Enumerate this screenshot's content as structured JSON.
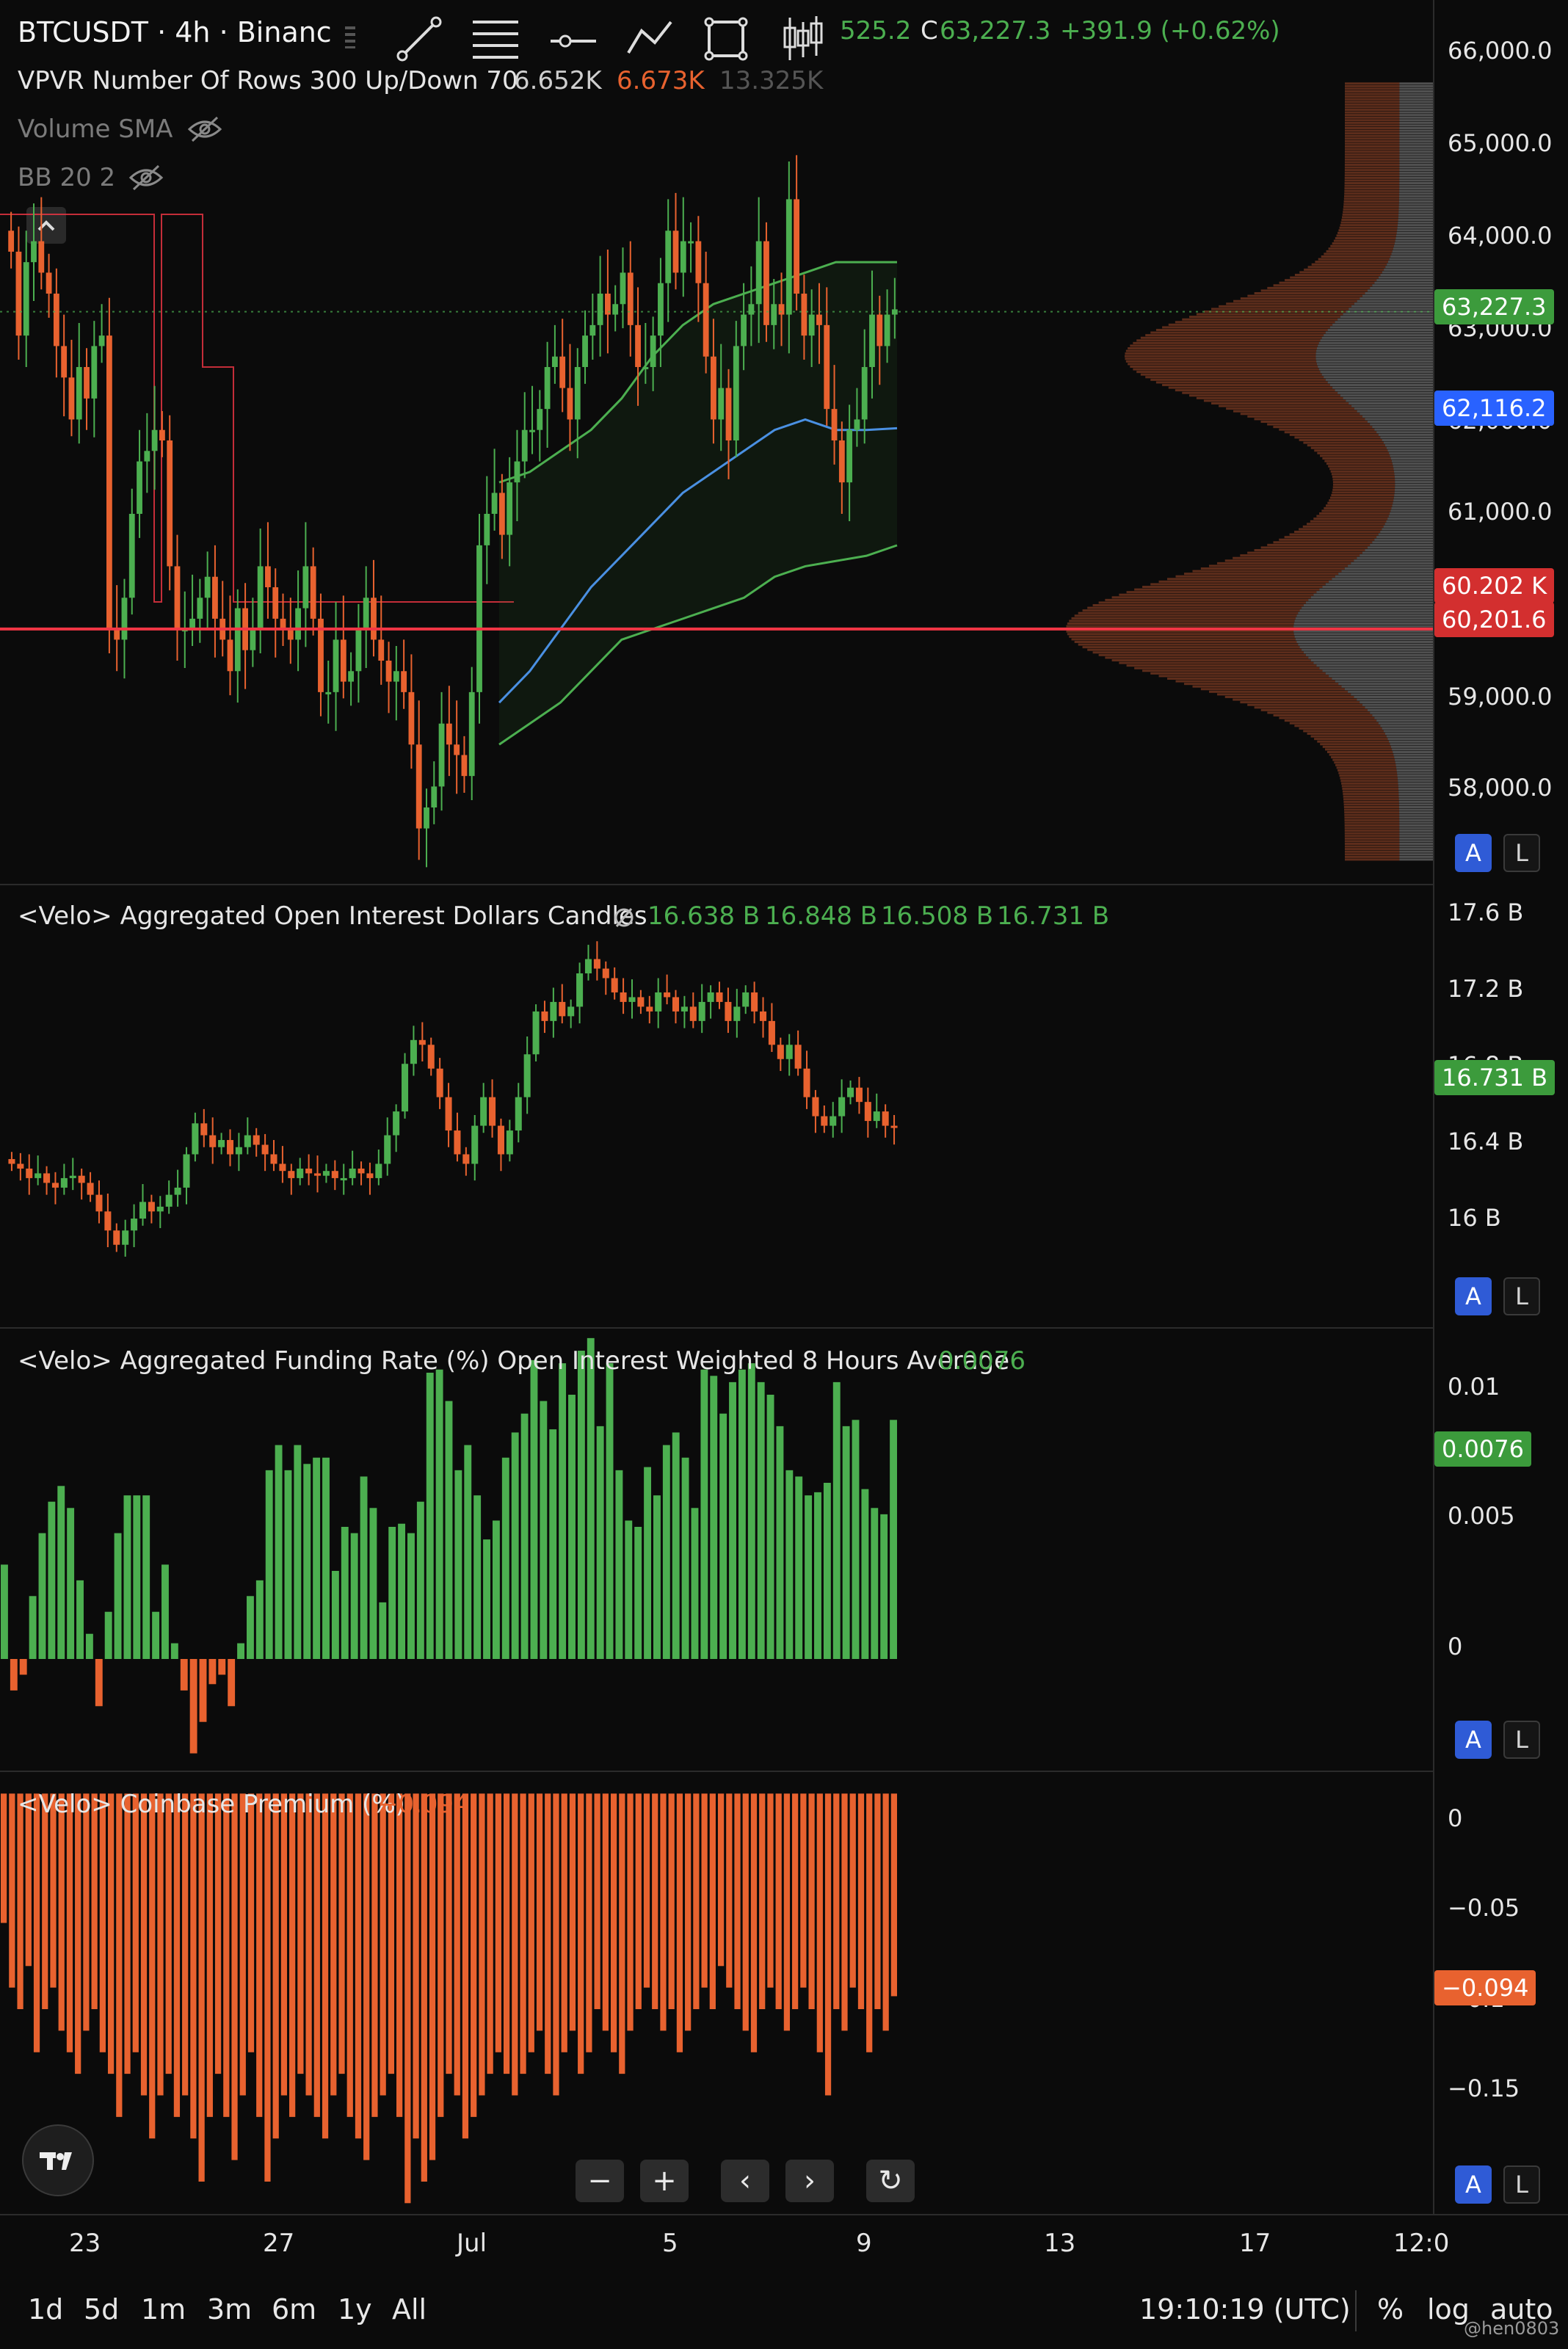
{
  "header": {
    "symbol": "BTCUSDT · 4h · Binanc",
    "ohlc_tail": "525.2",
    "close_letter": "C",
    "close_value": "63,227.3",
    "change": "+391.9 (+0.62%)"
  },
  "indicators": {
    "vpvr": {
      "name": "VPVR Number Of Rows 300 Up/Down 70",
      "v1": "6.652K",
      "v2": "6.673K",
      "v3": "13.325K"
    },
    "volume_sma": "Volume SMA",
    "bb": "BB 20 2"
  },
  "colors": {
    "up": "#4caf50",
    "down": "#e8622f",
    "line_red": "#f23645",
    "ma_blue": "#4a90e2",
    "badge_green": "#3c9b3c",
    "badge_blue": "#2962ff",
    "badge_red": "#d32f2f",
    "badge_orange": "#e8622f",
    "al_blue": "#2f5bd6"
  },
  "price_pane": {
    "yticks": [
      "66,000.0",
      "65,000.0",
      "64,000.0",
      "63,000.0",
      "62,000.0",
      "61,000.0",
      "59,000.0",
      "58,000.0"
    ],
    "badges": {
      "last": "63,227.3",
      "ma": "62,116.2",
      "line1": "60.202 K",
      "line2": "60,201.6"
    }
  },
  "oi_pane": {
    "title": "<Velo> Aggregated Open Interest Dollars Candles",
    "o": "16.638 B",
    "h": "16.848 B",
    "l": "16.508 B",
    "c": "16.731 B",
    "yticks": [
      "17.6 B",
      "17.2 B",
      "16.8 B",
      "16.4 B",
      "16 B"
    ],
    "badge": "16.731 B"
  },
  "funding_pane": {
    "title": "<Velo> Aggregated Funding Rate (%) Open Interest Weighted 8 Hours Average",
    "value": "0.0076",
    "yticks": [
      "0.01",
      "0.005",
      "0"
    ],
    "badge": "0.0076"
  },
  "premium_pane": {
    "title": "<Velo> Coinbase Premium (%)",
    "value": "−0.094",
    "yticks": [
      "0",
      "−0.05",
      "−0.1",
      "−0.15"
    ],
    "badge": "−0.094"
  },
  "scale_buttons": {
    "auto_label": "A",
    "log_label": "L"
  },
  "xaxis": [
    "23",
    "27",
    "Jul",
    "5",
    "9",
    "13",
    "17",
    "12:0"
  ],
  "timeframes": [
    "1d",
    "5d",
    "1m",
    "3m",
    "6m",
    "1y",
    "All"
  ],
  "footer": {
    "clock": "19:10:19 (UTC)",
    "percent": "%",
    "log": "log",
    "auto": "auto",
    "watermark": "@hen0803"
  },
  "nav": {
    "minus": "−",
    "plus": "+",
    "prev": "‹",
    "next": "›",
    "reset": "↻"
  },
  "chart_data": [
    {
      "type": "candlestick",
      "title": "BTCUSDT · 4h",
      "ylim": [
        57800,
        66200
      ],
      "values": [
        63800,
        63000,
        63700,
        63900,
        63600,
        63400,
        62900,
        62600,
        62200,
        62700,
        62400,
        62900,
        63000,
        60200,
        60100,
        60500,
        61300,
        61800,
        61900,
        62100,
        62000,
        60800,
        60200,
        60200,
        60300,
        60500,
        60700,
        60300,
        60100,
        59800,
        60400,
        60000,
        60200,
        60800,
        60600,
        60300,
        60200,
        60100,
        60400,
        60800,
        60300,
        59600,
        59600,
        60100,
        59700,
        59800,
        60200,
        60500,
        60100,
        59900,
        59700,
        59800,
        59600,
        59100,
        58300,
        58500,
        58700,
        59300,
        59100,
        59000,
        58800,
        59600,
        61000,
        61300,
        61500,
        61100,
        61600,
        61800,
        62100,
        62100,
        62300,
        62700,
        62800,
        62500,
        62200,
        62700,
        63000,
        63100,
        63400,
        63200,
        63300,
        63600,
        63100,
        62700,
        62700,
        63000,
        63500,
        64000,
        63600,
        63900,
        63900,
        63500,
        62800,
        62200,
        62500,
        62000,
        62900,
        63200,
        63300,
        63900,
        63100,
        63300,
        63200,
        64300,
        63400,
        63000,
        63200,
        63100,
        62300,
        62000,
        61600,
        62100,
        62200,
        62700,
        63200,
        62900,
        63200,
        63250
      ]
    },
    {
      "type": "line",
      "series": [
        {
          "name": "BB upper",
          "values": [
            61600,
            61700,
            61900,
            62100,
            62400,
            62800,
            63100,
            63300,
            63400,
            63500,
            63600,
            63700,
            63700,
            63700
          ]
        },
        {
          "name": "BB basis",
          "values": [
            59500,
            59800,
            60200,
            60600,
            60900,
            61200,
            61500,
            61700,
            61900,
            62100,
            62200,
            62100,
            62100,
            62116
          ]
        },
        {
          "name": "BB lower",
          "values": [
            59100,
            59300,
            59500,
            59800,
            60100,
            60200,
            60300,
            60400,
            60500,
            60700,
            60800,
            60850,
            60900,
            61000
          ]
        }
      ]
    },
    {
      "type": "candlestick",
      "title": "<Velo> Aggregated Open Interest Dollars Candles",
      "ylim": [
        15.9,
        17.75
      ],
      "values": [
        16.58,
        16.56,
        16.52,
        16.54,
        16.5,
        16.48,
        16.52,
        16.53,
        16.5,
        16.45,
        16.38,
        16.3,
        16.24,
        16.3,
        16.35,
        16.42,
        16.38,
        16.4,
        16.45,
        16.48,
        16.62,
        16.75,
        16.7,
        16.65,
        16.68,
        16.62,
        16.65,
        16.7,
        16.66,
        16.62,
        16.58,
        16.55,
        16.52,
        16.56,
        16.54,
        16.53,
        16.55,
        16.52,
        16.52,
        16.56,
        16.54,
        16.52,
        16.58,
        16.7,
        16.8,
        17.0,
        17.1,
        17.08,
        16.98,
        16.86,
        16.72,
        16.62,
        16.58,
        16.74,
        16.86,
        16.74,
        16.62,
        16.72,
        16.86,
        17.04,
        17.22,
        17.18,
        17.26,
        17.2,
        17.24,
        17.38,
        17.44,
        17.4,
        17.36,
        17.3,
        17.26,
        17.28,
        17.24,
        17.22,
        17.3,
        17.28,
        17.22,
        17.24,
        17.18,
        17.26,
        17.3,
        17.26,
        17.18,
        17.24,
        17.3,
        17.22,
        17.18,
        17.08,
        17.02,
        17.08,
        16.98,
        16.86,
        16.78,
        16.74,
        16.78,
        16.86,
        16.9,
        16.84,
        16.76,
        16.8,
        16.74,
        16.731
      ]
    },
    {
      "type": "bar",
      "title": "<Velo> Aggregated Funding Rate (%) Open Interest Weighted 8 Hours Average",
      "ylim": [
        -0.0035,
        0.0105
      ],
      "values": [
        0.003,
        -0.001,
        -0.0005,
        0.002,
        0.004,
        0.005,
        0.0055,
        0.0048,
        0.0025,
        0.0008,
        -0.0015,
        0.0015,
        0.004,
        0.0052,
        0.0052,
        0.0052,
        0.0015,
        0.003,
        0.0005,
        -0.001,
        -0.003,
        -0.002,
        -0.0008,
        -0.0005,
        -0.0015,
        0.0005,
        0.002,
        0.0025,
        0.006,
        0.0068,
        0.006,
        0.0068,
        0.0062,
        0.0064,
        0.0064,
        0.0028,
        0.0042,
        0.004,
        0.0058,
        0.0048,
        0.0018,
        0.0042,
        0.0043,
        0.004,
        0.005,
        0.0091,
        0.0092,
        0.0082,
        0.006,
        0.0068,
        0.0052,
        0.0038,
        0.0044,
        0.0064,
        0.0072,
        0.0078,
        0.0095,
        0.0082,
        0.0073,
        0.0094,
        0.0084,
        0.0098,
        0.0102,
        0.0074,
        0.0094,
        0.006,
        0.0044,
        0.0042,
        0.0061,
        0.0052,
        0.0068,
        0.0072,
        0.0064,
        0.0048,
        0.0092,
        0.009,
        0.0078,
        0.0088,
        0.0092,
        0.0094,
        0.0088,
        0.0084,
        0.0074,
        0.006,
        0.0058,
        0.0052,
        0.0053,
        0.0056,
        0.0088,
        0.0074,
        0.0076,
        0.0054,
        0.0048,
        0.0046,
        0.0076
      ]
    },
    {
      "type": "bar",
      "title": "<Velo> Coinbase Premium (%)",
      "ylim": [
        -0.195,
        0.01
      ],
      "values": [
        -0.06,
        -0.09,
        -0.1,
        -0.08,
        -0.12,
        -0.1,
        -0.09,
        -0.11,
        -0.12,
        -0.13,
        -0.11,
        -0.1,
        -0.12,
        -0.13,
        -0.15,
        -0.13,
        -0.12,
        -0.14,
        -0.16,
        -0.14,
        -0.13,
        -0.15,
        -0.14,
        -0.16,
        -0.18,
        -0.15,
        -0.13,
        -0.15,
        -0.17,
        -0.14,
        -0.12,
        -0.15,
        -0.18,
        -0.16,
        -0.14,
        -0.15,
        -0.13,
        -0.14,
        -0.15,
        -0.16,
        -0.14,
        -0.13,
        -0.15,
        -0.16,
        -0.17,
        -0.15,
        -0.14,
        -0.13,
        -0.15,
        -0.19,
        -0.16,
        -0.18,
        -0.17,
        -0.15,
        -0.13,
        -0.14,
        -0.16,
        -0.15,
        -0.14,
        -0.13,
        -0.12,
        -0.13,
        -0.14,
        -0.13,
        -0.12,
        -0.11,
        -0.13,
        -0.14,
        -0.12,
        -0.11,
        -0.13,
        -0.12,
        -0.1,
        -0.11,
        -0.12,
        -0.13,
        -0.11,
        -0.1,
        -0.09,
        -0.1,
        -0.11,
        -0.1,
        -0.12,
        -0.11,
        -0.1,
        -0.09,
        -0.1,
        -0.08,
        -0.09,
        -0.1,
        -0.11,
        -0.12,
        -0.1,
        -0.09,
        -0.1,
        -0.11,
        -0.1,
        -0.09,
        -0.1,
        -0.12,
        -0.14,
        -0.1,
        -0.11,
        -0.09,
        -0.1,
        -0.12,
        -0.1,
        -0.11,
        -0.094
      ]
    }
  ]
}
